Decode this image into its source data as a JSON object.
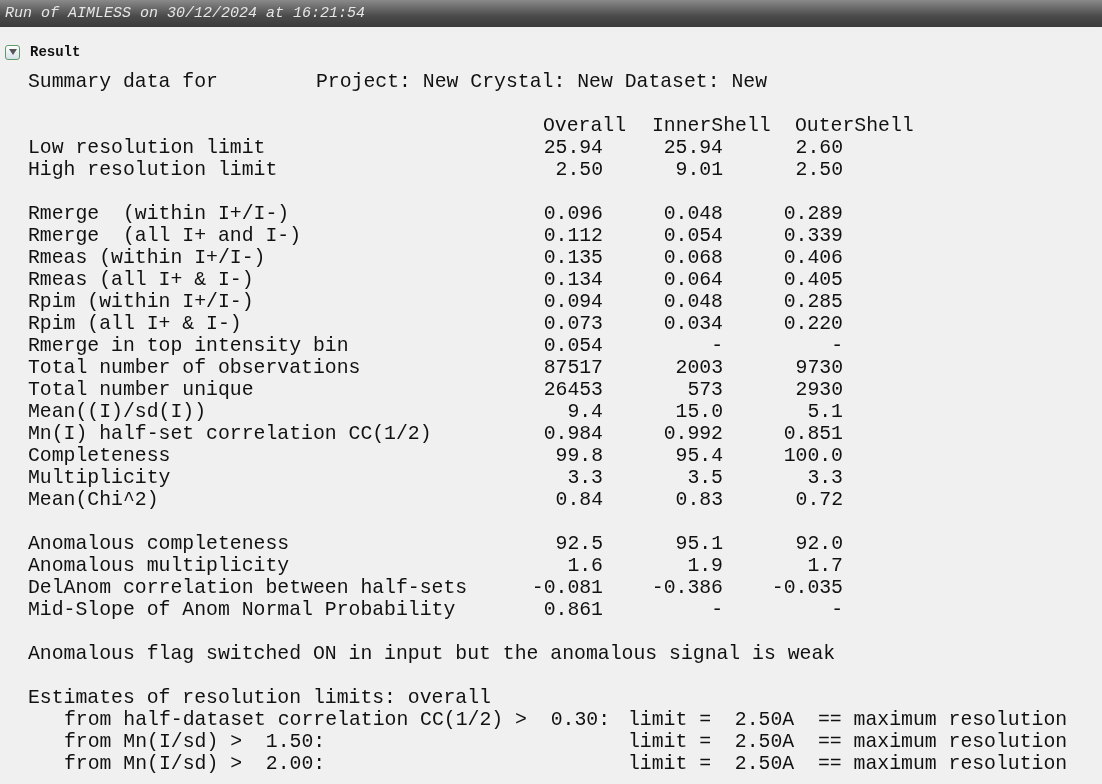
{
  "title": "Run of AIMLESS on 30/12/2024 at 16:21:54",
  "section": {
    "label": "Result",
    "expanded": true
  },
  "summary": {
    "label": "Summary data for",
    "project": "Project: New Crystal: New Dataset: New"
  },
  "columns": [
    "Overall",
    "InnerShell",
    "OuterShell"
  ],
  "groups": [
    [
      {
        "label": "Low resolution limit",
        "values": [
          "25.94",
          "25.94",
          "2.60"
        ]
      },
      {
        "label": "High resolution limit",
        "values": [
          "2.50",
          "9.01",
          "2.50"
        ]
      }
    ],
    [
      {
        "label": "Rmerge  (within I+/I-)",
        "values": [
          "0.096",
          "0.048",
          "0.289"
        ]
      },
      {
        "label": "Rmerge  (all I+ and I-)",
        "values": [
          "0.112",
          "0.054",
          "0.339"
        ]
      },
      {
        "label": "Rmeas (within I+/I-)",
        "values": [
          "0.135",
          "0.068",
          "0.406"
        ]
      },
      {
        "label": "Rmeas (all I+ & I-)",
        "values": [
          "0.134",
          "0.064",
          "0.405"
        ]
      },
      {
        "label": "Rpim (within I+/I-)",
        "values": [
          "0.094",
          "0.048",
          "0.285"
        ]
      },
      {
        "label": "Rpim (all I+ & I-)",
        "values": [
          "0.073",
          "0.034",
          "0.220"
        ]
      },
      {
        "label": "Rmerge in top intensity bin",
        "values": [
          "0.054",
          "-",
          "-"
        ]
      },
      {
        "label": "Total number of observations",
        "values": [
          "87517",
          "2003",
          "9730"
        ]
      },
      {
        "label": "Total number unique",
        "values": [
          "26453",
          "573",
          "2930"
        ]
      },
      {
        "label": "Mean((I)/sd(I))",
        "values": [
          "9.4",
          "15.0",
          "5.1"
        ]
      },
      {
        "label": "Mn(I) half-set correlation CC(1/2)",
        "values": [
          "0.984",
          "0.992",
          "0.851"
        ]
      },
      {
        "label": "Completeness",
        "values": [
          "99.8",
          "95.4",
          "100.0"
        ]
      },
      {
        "label": "Multiplicity",
        "values": [
          "3.3",
          "3.5",
          "3.3"
        ]
      },
      {
        "label": "Mean(Chi^2)",
        "values": [
          "0.84",
          "0.83",
          "0.72"
        ]
      }
    ],
    [
      {
        "label": "Anomalous completeness",
        "values": [
          "92.5",
          "95.1",
          "92.0"
        ]
      },
      {
        "label": "Anomalous multiplicity",
        "values": [
          "1.6",
          "1.9",
          "1.7"
        ]
      },
      {
        "label": "DelAnom correlation between half-sets",
        "values": [
          "-0.081",
          "-0.386",
          "-0.035"
        ]
      },
      {
        "label": "Mid-Slope of Anom Normal Probability",
        "values": [
          "0.861",
          "-",
          "-"
        ]
      }
    ]
  ],
  "note": "Anomalous flag switched ON in input but the anomalous signal is weak",
  "estimates": {
    "heading": "Estimates of resolution limits: overall",
    "items": [
      {
        "condition": "from half-dataset correlation CC(1/2) >  0.30:",
        "result": "limit =  2.50A  == maximum resolution"
      },
      {
        "condition": "from Mn(I/sd) >  1.50:",
        "result": "limit =  2.50A  == maximum resolution"
      },
      {
        "condition": "from Mn(I/sd) >  2.00:",
        "result": "limit =  2.50A  == maximum resolution"
      }
    ]
  }
}
